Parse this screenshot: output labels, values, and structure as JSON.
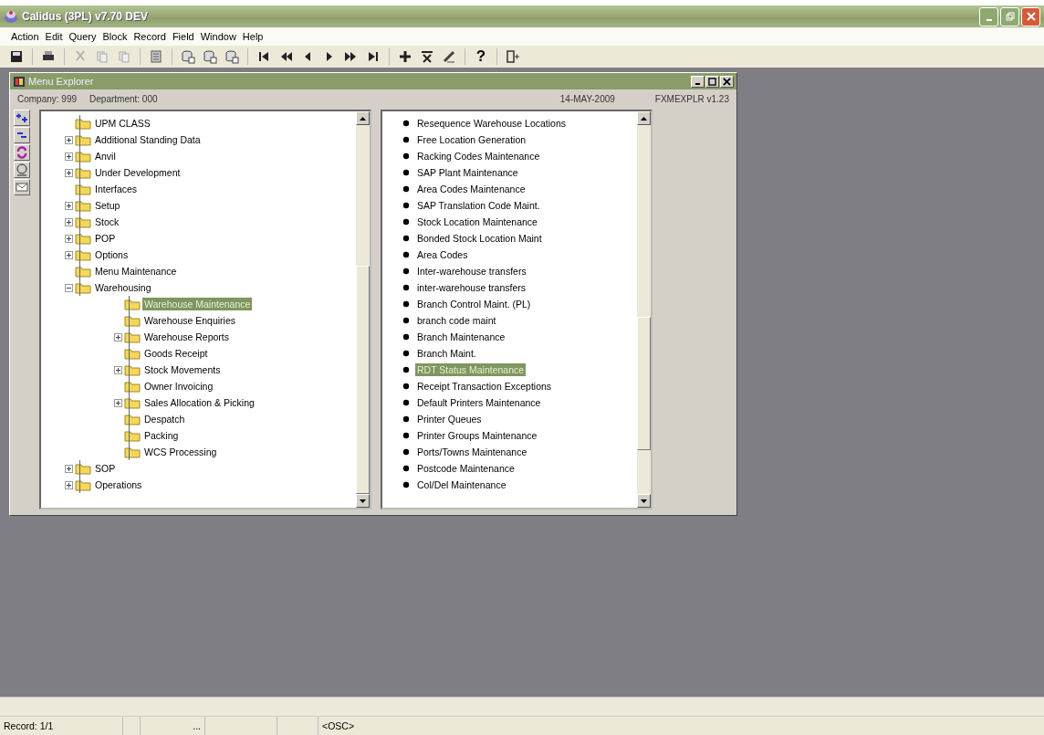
{
  "window": {
    "title": "Calidus (3PL) v7.70 DEV"
  },
  "menu": [
    "Action",
    "Edit",
    "Query",
    "Block",
    "Record",
    "Field",
    "Window",
    "Help"
  ],
  "toolbar": {
    "help_label": "?"
  },
  "child_window": {
    "title": "Menu Explorer",
    "company": "Company: 999",
    "department": "Department: 000",
    "date": "14-MAY-2009",
    "version": "FXMEXPLR  v1.23"
  },
  "tree": [
    {
      "label": "UPM CLASS",
      "kind": "leaf",
      "selected": false
    },
    {
      "label": "Additional Standing Data",
      "kind": "branch",
      "expanded": false,
      "selected": false
    },
    {
      "label": "Anvil",
      "kind": "branch",
      "expanded": false,
      "selected": false
    },
    {
      "label": "Under Development",
      "kind": "branch",
      "expanded": false,
      "selected": false
    },
    {
      "label": "Interfaces",
      "kind": "leaf",
      "selected": false
    },
    {
      "label": "Setup",
      "kind": "branch",
      "expanded": false,
      "selected": false
    },
    {
      "label": "Stock",
      "kind": "branch",
      "expanded": false,
      "selected": false
    },
    {
      "label": "POP",
      "kind": "branch",
      "expanded": false,
      "selected": false
    },
    {
      "label": "Options",
      "kind": "branch",
      "expanded": false,
      "selected": false
    },
    {
      "label": "Menu Maintenance",
      "kind": "leaf",
      "selected": false
    },
    {
      "label": "Warehousing",
      "kind": "branch",
      "expanded": true,
      "selected": false,
      "children": [
        {
          "label": "Warehouse Maintenance",
          "kind": "leaf",
          "selected": true
        },
        {
          "label": "Warehouse Enquiries",
          "kind": "leaf",
          "selected": false
        },
        {
          "label": "Warehouse Reports",
          "kind": "branch",
          "expanded": false,
          "selected": false
        },
        {
          "label": "Goods Receipt",
          "kind": "leaf",
          "selected": false
        },
        {
          "label": "Stock Movements",
          "kind": "branch",
          "expanded": false,
          "selected": false
        },
        {
          "label": "Owner Invoicing",
          "kind": "leaf",
          "selected": false
        },
        {
          "label": "Sales Allocation & Picking",
          "kind": "branch",
          "expanded": false,
          "selected": false
        },
        {
          "label": "Despatch",
          "kind": "leaf",
          "selected": false
        },
        {
          "label": "Packing",
          "kind": "leaf",
          "selected": false
        },
        {
          "label": "WCS Processing",
          "kind": "leaf",
          "selected": false
        }
      ]
    },
    {
      "label": "SOP",
      "kind": "branch",
      "expanded": false,
      "selected": false
    },
    {
      "label": "Operations",
      "kind": "branch",
      "expanded": false,
      "selected": false
    }
  ],
  "list": [
    {
      "label": "Resequence Warehouse Locations",
      "selected": false
    },
    {
      "label": "Free Location Generation",
      "selected": false
    },
    {
      "label": "Racking Codes Maintenance",
      "selected": false
    },
    {
      "label": "SAP Plant Maintenance",
      "selected": false
    },
    {
      "label": "Area Codes Maintenance",
      "selected": false
    },
    {
      "label": "SAP Translation Code Maint.",
      "selected": false
    },
    {
      "label": "Stock Location Maintenance",
      "selected": false
    },
    {
      "label": "Bonded Stock Location Maint",
      "selected": false
    },
    {
      "label": "Area Codes",
      "selected": false
    },
    {
      "label": "Inter-warehouse transfers",
      "selected": false
    },
    {
      "label": "inter-warehouse transfers",
      "selected": false
    },
    {
      "label": "Branch Control Maint. (PL)",
      "selected": false
    },
    {
      "label": "branch code maint",
      "selected": false
    },
    {
      "label": "Branch Maintenance",
      "selected": false
    },
    {
      "label": "Branch Maint.",
      "selected": false
    },
    {
      "label": "RDT Status Maintenance",
      "selected": true
    },
    {
      "label": "Receipt Transaction Exceptions",
      "selected": false
    },
    {
      "label": "Default Printers Maintenance",
      "selected": false
    },
    {
      "label": "Printer Queues",
      "selected": false
    },
    {
      "label": "Printer Groups Maintenance",
      "selected": false
    },
    {
      "label": "Ports/Towns Maintenance",
      "selected": false
    },
    {
      "label": "Postcode Maintenance",
      "selected": false
    },
    {
      "label": "Col/Del Maintenance",
      "selected": false
    }
  ],
  "status_bar": {
    "record": "Record: 1/1",
    "ellipsis": "...",
    "mode": "<OSC>"
  }
}
